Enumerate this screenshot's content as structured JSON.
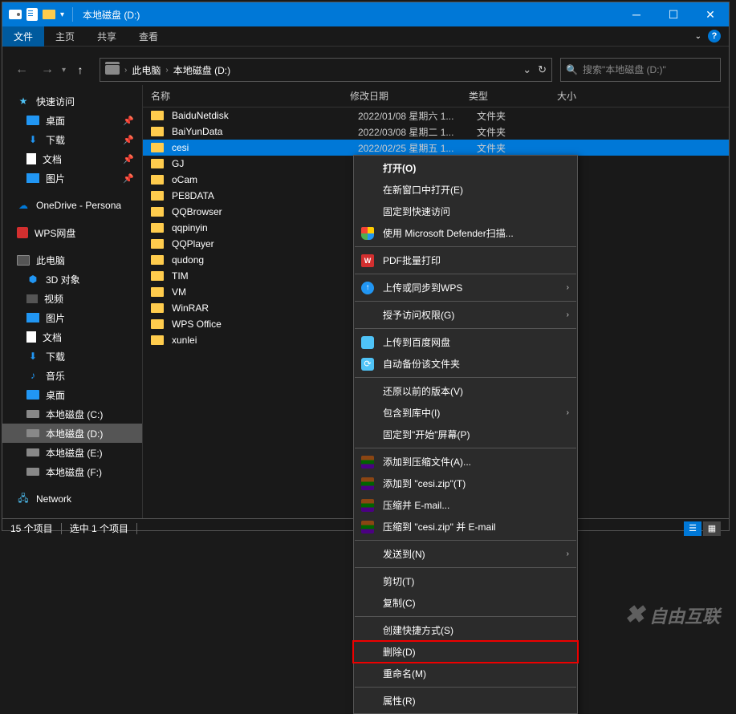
{
  "window": {
    "title": "本地磁盘 (D:)"
  },
  "ribbon": {
    "file": "文件",
    "tabs": [
      "主页",
      "共享",
      "查看"
    ]
  },
  "breadcrumb": {
    "pc": "此电脑",
    "drive": "本地磁盘 (D:)"
  },
  "search": {
    "placeholder": "搜索\"本地磁盘 (D:)\""
  },
  "sidebar": {
    "quickAccess": "快速访问",
    "desktop": "桌面",
    "downloads": "下载",
    "documents": "文档",
    "pictures": "图片",
    "onedrive": "OneDrive - Persona",
    "wps": "WPS网盘",
    "thispc": "此电脑",
    "objects3d": "3D 对象",
    "videos": "视频",
    "pictures2": "图片",
    "documents2": "文档",
    "downloads2": "下载",
    "music": "音乐",
    "desktop2": "桌面",
    "driveC": "本地磁盘 (C:)",
    "driveD": "本地磁盘 (D:)",
    "driveE": "本地磁盘 (E:)",
    "driveF": "本地磁盘 (F:)",
    "network": "Network"
  },
  "columns": {
    "name": "名称",
    "date": "修改日期",
    "type": "类型",
    "size": "大小"
  },
  "files": [
    {
      "name": "BaiduNetdisk",
      "date": "2022/01/08 星期六 1...",
      "type": "文件夹"
    },
    {
      "name": "BaiYunData",
      "date": "2022/03/08 星期二 1...",
      "type": "文件夹"
    },
    {
      "name": "cesi",
      "date": "2022/02/25 星期五 1...",
      "type": "文件夹"
    },
    {
      "name": "GJ",
      "date": "",
      "type": ""
    },
    {
      "name": "oCam",
      "date": "",
      "type": ""
    },
    {
      "name": "PE8DATA",
      "date": "",
      "type": ""
    },
    {
      "name": "QQBrowser",
      "date": "",
      "type": ""
    },
    {
      "name": "qqpinyin",
      "date": "",
      "type": ""
    },
    {
      "name": "QQPlayer",
      "date": "",
      "type": ""
    },
    {
      "name": "qudong",
      "date": "",
      "type": ""
    },
    {
      "name": "TIM",
      "date": "",
      "type": ""
    },
    {
      "name": "VM",
      "date": "",
      "type": ""
    },
    {
      "name": "WinRAR",
      "date": "",
      "type": ""
    },
    {
      "name": "WPS Office",
      "date": "",
      "type": ""
    },
    {
      "name": "xunlei",
      "date": "",
      "type": ""
    }
  ],
  "status": {
    "count": "15 个项目",
    "selected": "选中 1 个项目"
  },
  "contextMenu": {
    "open": "打开(O)",
    "openNewWindow": "在新窗口中打开(E)",
    "pinQuick": "固定到快速访问",
    "defender": "使用 Microsoft Defender扫描...",
    "pdfBatch": "PDF批量打印",
    "wpsSync": "上传或同步到WPS",
    "grantAccess": "授予访问权限(G)",
    "baiduUpload": "上传到百度网盘",
    "autoBackup": "自动备份该文件夹",
    "restorePrev": "还原以前的版本(V)",
    "includeLib": "包含到库中(I)",
    "pinStart": "固定到\"开始\"屏幕(P)",
    "addArchive": "添加到压缩文件(A)...",
    "addZip": "添加到 \"cesi.zip\"(T)",
    "compressEmail": "压缩并 E-mail...",
    "compressZipEmail": "压缩到 \"cesi.zip\" 并 E-mail",
    "sendTo": "发送到(N)",
    "cut": "剪切(T)",
    "copy": "复制(C)",
    "shortcut": "创建快捷方式(S)",
    "delete": "删除(D)",
    "rename": "重命名(M)",
    "properties": "属性(R)"
  },
  "watermark": "自由互联"
}
